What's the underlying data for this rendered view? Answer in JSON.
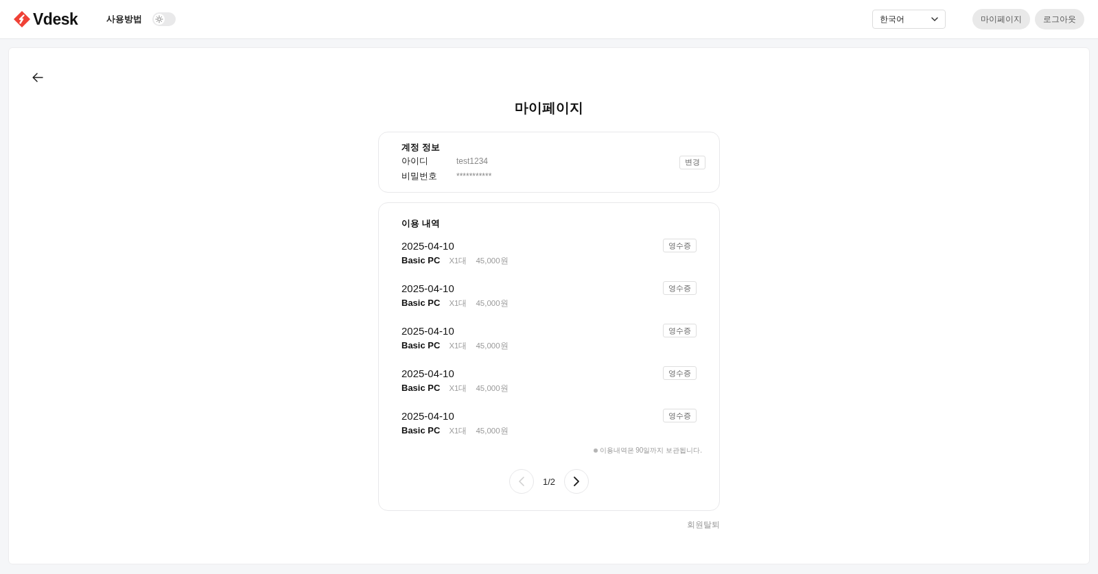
{
  "header": {
    "logo": "Vdesk",
    "guide_link": "사용방법",
    "theme_toggle": {
      "on": false
    },
    "language_select": {
      "value": "한국어"
    },
    "buttons": [
      "마이페이지",
      "로그아웃"
    ]
  },
  "page": {
    "title": "마이페이지"
  },
  "account": {
    "heading": "계정 정보",
    "fields": [
      {
        "label": "아이디",
        "value": "test1234"
      },
      {
        "label": "비밀번호",
        "value": "***********"
      }
    ],
    "change_button": "변경"
  },
  "history": {
    "heading": "이용 내역",
    "entries": [
      {
        "date": "2025-04-10",
        "product": "Basic PC",
        "quantity": "X1대",
        "price": "45,000원",
        "receipt_button": "영수증"
      },
      {
        "date": "2025-04-10",
        "product": "Basic PC",
        "quantity": "X1대",
        "price": "45,000원",
        "receipt_button": "영수증"
      },
      {
        "date": "2025-04-10",
        "product": "Basic PC",
        "quantity": "X1대",
        "price": "45,000원",
        "receipt_button": "영수증"
      },
      {
        "date": "2025-04-10",
        "product": "Basic PC",
        "quantity": "X1대",
        "price": "45,000원",
        "receipt_button": "영수증"
      },
      {
        "date": "2025-04-10",
        "product": "Basic PC",
        "quantity": "X1대",
        "price": "45,000원",
        "receipt_button": "영수증"
      }
    ],
    "note": "이용내역은 90일까지 보관됩니다.",
    "pagination": {
      "prev": {
        "disabled": true
      },
      "page_label": "1/2",
      "next": {
        "disabled": false
      }
    }
  },
  "withdraw_link": "회원탈퇴"
}
